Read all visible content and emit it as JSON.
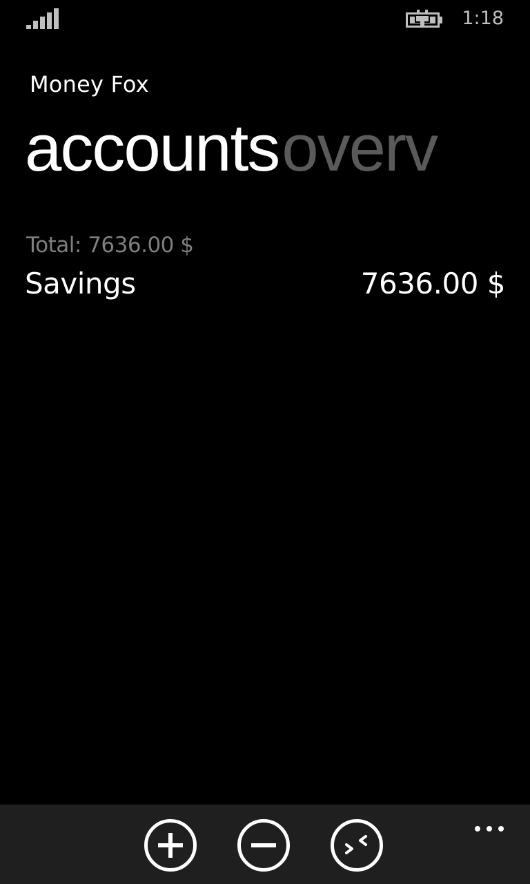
{
  "status_bar": {
    "time": "1:18",
    "signal_icon": "signal-strength-icon",
    "battery_icon": "battery-charging-icon"
  },
  "header": {
    "app_title": "Money Fox",
    "pivots": [
      "accounts",
      "overv"
    ]
  },
  "summary": {
    "total_label": "Total: 7636.00 $"
  },
  "accounts": [
    {
      "name": "Savings",
      "balance": "7636.00 $"
    }
  ],
  "app_bar": {
    "buttons": [
      {
        "icon": "add-circle-icon"
      },
      {
        "icon": "subtract-circle-icon"
      },
      {
        "icon": "transfer-circle-icon"
      }
    ],
    "more_icon": "ellipsis-icon"
  },
  "colors": {
    "background": "#000000",
    "app_bar": "#1f1f1f",
    "foreground": "#ffffff",
    "inactive_pivot": "#5a5a5a",
    "subtle_text": "#7f7f7f"
  }
}
